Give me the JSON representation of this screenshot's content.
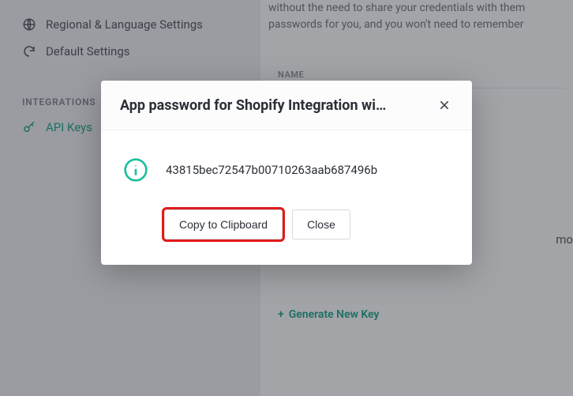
{
  "sidebar": {
    "items": [
      {
        "label": "Regional & Language Settings"
      },
      {
        "label": "Default Settings"
      }
    ],
    "section_heading": "INTEGRATIONS",
    "integration_items": [
      {
        "label": "API Keys"
      }
    ]
  },
  "main": {
    "desc_line1": "without the need to share your credentials with them",
    "desc_line2": "passwords for you, and you won't need to remember",
    "table_header": "NAME",
    "generate_label": "Generate New Key",
    "demo_text": "mo"
  },
  "modal": {
    "title": "App password for Shopify Integration wi…",
    "value": "43815bec72547b00710263aab687496b",
    "copy_label": "Copy to Clipboard",
    "close_label": "Close"
  }
}
